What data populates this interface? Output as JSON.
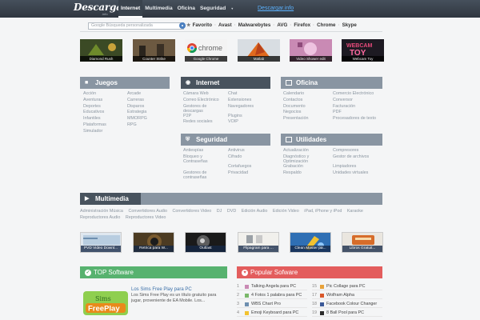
{
  "topbar": {
    "logo": "Descargar",
    "logo_sub": ".info",
    "nav": [
      {
        "label": "Internet",
        "active": true
      },
      {
        "label": "Multimedia",
        "active": false
      },
      {
        "label": "Oficina",
        "active": false
      },
      {
        "label": "Seguridad",
        "active": false
      }
    ],
    "more_caret": "▾",
    "site_link": "Descargar.info"
  },
  "search": {
    "placeholder": "Google Búsqueda personalizada"
  },
  "bookmarks": [
    "Favorito",
    "Avast",
    "Malwarebytes",
    "AVG",
    "Firefox",
    "Chrome",
    "Skype"
  ],
  "tiles": [
    {
      "label": "Diamond Rush",
      "color": "#3b4a25"
    },
    {
      "label": "Counter Strike",
      "color": "#5c4a35"
    },
    {
      "label": "Google Chrome",
      "color": "#f1f1f1"
    },
    {
      "label": "Matlab",
      "color": "#a75a2a"
    },
    {
      "label": "Video Shower edit",
      "color": "#b66a9c"
    },
    {
      "label": "Webcam Toy",
      "color": "#1d1a22"
    }
  ],
  "categories": {
    "juegos": {
      "title": "Juegos",
      "links": [
        "Acción",
        "Arcade",
        "Aventuras",
        "Carreras",
        "Deportes",
        "Disparos",
        "Educativos",
        "Estrategia",
        "Infantiles",
        "MMORPG",
        "Plataformas",
        "RPG",
        "Simulador",
        ""
      ]
    },
    "internet": {
      "title": "Internet",
      "links": [
        "Cámara Web",
        "Chat",
        "Correo Electrónico",
        "Extensiones",
        "Gestores de descargas",
        "Navegadores",
        "P2P",
        "Plugins",
        "Redes sociales",
        "VOIP"
      ]
    },
    "oficina": {
      "title": "Oficina",
      "links": [
        "Calendario",
        "Comercio Electrónico",
        "Contactos",
        "Conversor",
        "Documento",
        "Facturación",
        "Negocios",
        "PDF",
        "Presentación",
        "Procesadores de texto"
      ]
    },
    "seguridad": {
      "title": "Seguridad",
      "links": [
        "Antiespías",
        "Antivirus",
        "Bloqueo y Contraseñas",
        "Cifrado",
        "Cortafuegos",
        "Cortafuegos",
        "Gestores de contraseñas",
        "Privacidad"
      ]
    },
    "utilidades": {
      "title": "Utilidades",
      "links": [
        "Actualización",
        "Compresores",
        "Diagnóstico y Optimización",
        "Gestor de archivos",
        "Grabación",
        "Limpiadores",
        "Respaldo",
        "Unidades virtuales"
      ]
    }
  },
  "multimedia": {
    "title": "Multimedia",
    "links": [
      "Administración Música",
      "Convertidores Audio",
      "Convertidores Video",
      "DJ",
      "DVD",
      "Edición Audio",
      "Edición Video",
      "iPad, iPhone y iPod",
      "Karaoke",
      "Reproductores Audio",
      "Reproductores Video"
    ]
  },
  "thumbs": [
    {
      "label": "PVD Video Downl...",
      "color": "#b8cde0"
    },
    {
      "label": "Retrica para W...",
      "color": "#4c3b22"
    },
    {
      "label": "Outlast",
      "color": "#2b2b2b"
    },
    {
      "label": "Flipagram para ...",
      "color": "#ecebe8"
    },
    {
      "label": "Clean Master pa...",
      "color": "#2f6fb4"
    },
    {
      "label": "Libros Gratuit...",
      "color": "#d66c2a"
    }
  ],
  "top_software": {
    "title": "TOP Software",
    "item_title": "Los Sims Free Play para PC",
    "item_desc": "Los Sims Free Play es un título gratuito para jugar, proveniente de EA Mobile. Los...",
    "logo_top": "Sims",
    "logo_bottom": "FreePlay"
  },
  "popular": {
    "title": "Popular Sofware",
    "items": [
      {
        "num": "1",
        "label": "Talking Angela para PC"
      },
      {
        "num": "15",
        "label": "Pic Collage para PC"
      },
      {
        "num": "2",
        "label": "4 Fotos 1 palabra para PC"
      },
      {
        "num": "17",
        "label": "Wolfram Alpha"
      },
      {
        "num": "3",
        "label": "WBS Chart Pro"
      },
      {
        "num": "18",
        "label": "Facebook Colour Changer"
      },
      {
        "num": "4",
        "label": "Emoji Keyboard para PC"
      },
      {
        "num": "19",
        "label": "8 Ball Pool para PC"
      }
    ]
  },
  "colors": {
    "green": "#57b26f",
    "red": "#e35d5d",
    "slate": "#8995a2"
  }
}
